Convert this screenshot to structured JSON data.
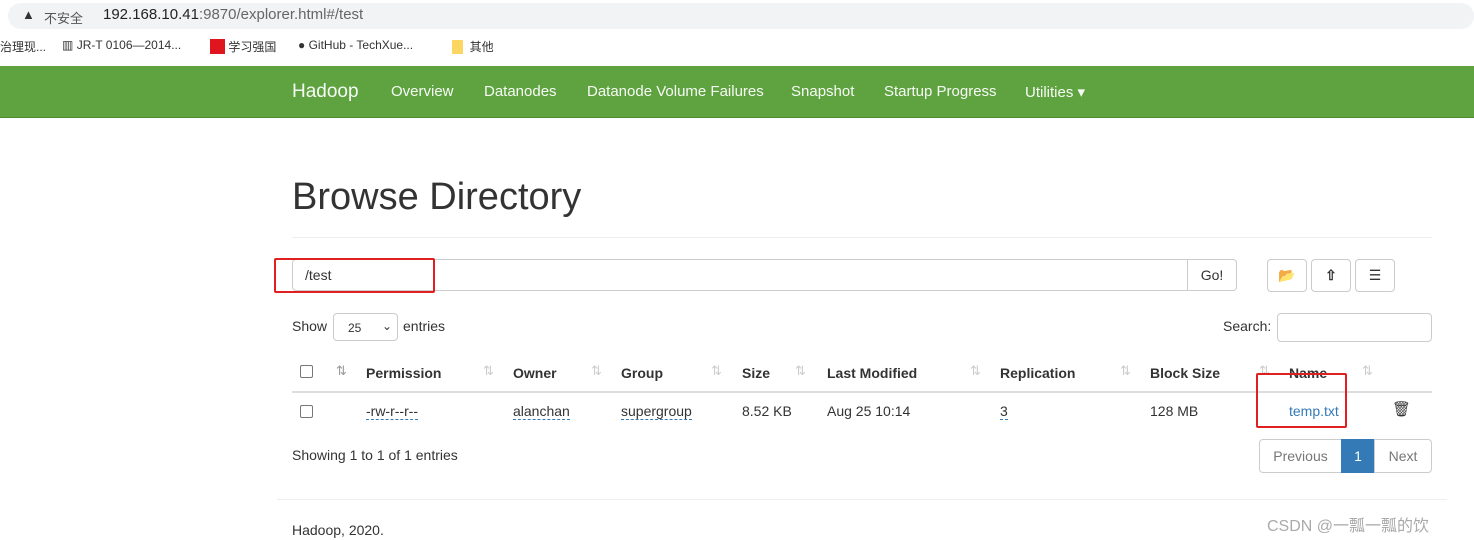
{
  "browser": {
    "security": "不安全",
    "url_host": "192.168.10.41",
    "url_rest": ":9870/explorer.html#/test",
    "bookmarks": [
      "治理现...",
      "JR-T 0106—2014...",
      "学习强国",
      "GitHub - TechXue...",
      "其他"
    ]
  },
  "nav": {
    "brand": "Hadoop",
    "items": [
      "Overview",
      "Datanodes",
      "Datanode Volume Failures",
      "Snapshot",
      "Startup Progress",
      "Utilities ▾"
    ]
  },
  "page": {
    "title": "Browse Directory",
    "path": "/test",
    "go": "Go!"
  },
  "table": {
    "show": "Show",
    "entries_value": "25",
    "entries": "entries",
    "search": "Search:",
    "headers": [
      "Permission",
      "Owner",
      "Group",
      "Size",
      "Last Modified",
      "Replication",
      "Block Size",
      "Name"
    ],
    "rows": [
      {
        "permission": "-rw-r--r--",
        "owner": "alanchan",
        "group": "supergroup",
        "size": "8.52 KB",
        "modified": "Aug 25 10:14",
        "replication": "3",
        "block_size": "128 MB",
        "name": "temp.txt"
      }
    ],
    "info": "Showing 1 to 1 of 1 entries",
    "prev": "Previous",
    "page": "1",
    "next": "Next"
  },
  "footer": "Hadoop, 2020.",
  "watermark": "CSDN @一瓢一瓢的饮"
}
